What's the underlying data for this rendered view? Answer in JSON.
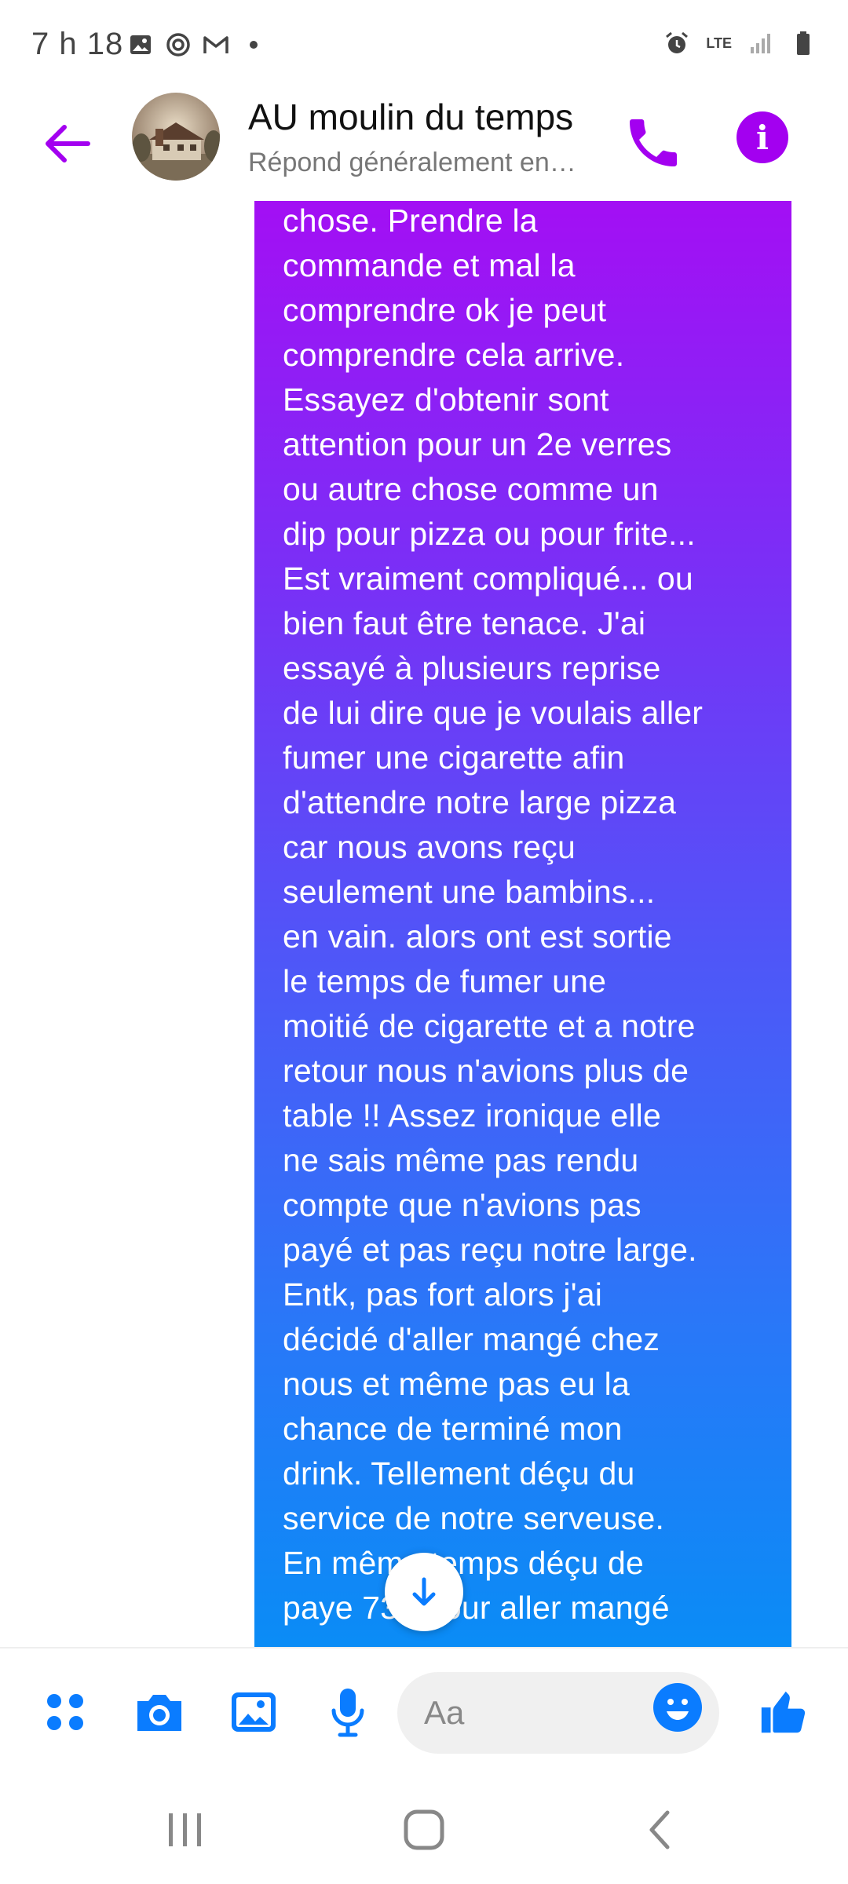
{
  "status_bar": {
    "time": "7 h 18",
    "network": "LTE"
  },
  "header": {
    "title": "AU moulin du temps",
    "subtitle": "Répond généralement en…"
  },
  "message": {
    "text": "peut pas dire la même\nchose. Prendre la\ncommande et mal la\ncomprendre ok je peut\ncomprendre cela arrive.\nEssayez d'obtenir sont\nattention  pour un 2e verres\nou autre chose comme un\ndip pour pizza ou pour frite...\nEst vraiment compliqué... ou\nbien faut être tenace. J'ai\nessayé à plusieurs reprise\nde lui dire que je voulais aller\nfumer une cigarette afin\nd'attendre notre large pizza\ncar nous avons reçu\nseulement une bambins...\nen vain. alors ont est sortie\nle temps de fumer une\nmoitié de cigarette et a notre\nretour nous n'avions plus de\ntable !! Assez ironique elle\nne sais même pas rendu\ncompte que n'avions pas\npayé et pas reçu notre large.\nEntk, pas fort alors j'ai\ndécidé d'aller mangé chez\nnous et même pas eu la\nchance de terminé mon\ndrink. Tellement déçu du\nservice de notre serveuse.\nEn même temps déçu de\npaye 73$ pour aller mangé",
    "gradient_start": "#a80bf4",
    "gradient_end": "#0a8cf6"
  },
  "composer": {
    "placeholder": "Aa"
  },
  "colors": {
    "accent_header": "#a300f0",
    "accent_composer": "#0a7cff"
  },
  "icons": {
    "header": [
      "back-arrow-icon",
      "phone-icon",
      "info-icon"
    ],
    "composer": [
      "apps-grid-icon",
      "camera-icon",
      "gallery-icon",
      "microphone-icon",
      "emoji-icon",
      "thumbs-up-icon"
    ],
    "nav": [
      "recent-apps-icon",
      "home-icon",
      "back-icon"
    ]
  }
}
